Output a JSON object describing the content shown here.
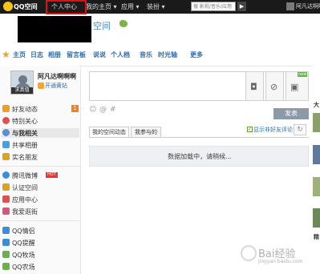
{
  "topbar": {
    "logo_text": "QQ空间",
    "nav": [
      "个人中心",
      "我的主页 ▾",
      "应用 ▾",
      "装扮 ▾"
    ],
    "search_placeholder": "搜 影视/音乐/应用",
    "search_button": "▶",
    "user_name": "阿凡达啊啊"
  },
  "header": {
    "space_text": "空间"
  },
  "mainnav": {
    "items": [
      "主页",
      "日志",
      "相册",
      "留言板",
      "说说",
      "个人档",
      "音乐",
      "时光轴",
      "更多"
    ]
  },
  "profile": {
    "name": "阿凡达啊啊啊",
    "avatar_label": "求真值",
    "vip_text": "开通黄钻"
  },
  "sidebar": {
    "group1": [
      {
        "label": "好友动态",
        "badge": "1",
        "color": "#f0a020"
      },
      {
        "label": "特别关心",
        "color": "#e05050"
      },
      {
        "label": "与我相关",
        "color": "#5a8fd0"
      },
      {
        "label": "共享相册",
        "color": "#4aa0d8"
      },
      {
        "label": "实名朋友",
        "color": "#e0a020"
      }
    ],
    "group2": [
      {
        "label": "腾讯微博",
        "hot": "HOT",
        "color": "#3b8ed8"
      },
      {
        "label": "认证空间",
        "color": "#e0a020"
      },
      {
        "label": "应用中心",
        "color": "#e05050"
      },
      {
        "label": "我爱逛街",
        "color": "#e05080"
      }
    ],
    "group3": [
      {
        "label": "QQ情侣",
        "color": "#3b8ed8"
      },
      {
        "label": "QQ提醒",
        "color": "#3b8ed8"
      },
      {
        "label": "QQ牧场",
        "color": "#6ab04c"
      },
      {
        "label": "QQ农场",
        "color": "#6ab04c"
      }
    ]
  },
  "composer": {
    "new_flag": "new",
    "post_button": "发表"
  },
  "feed": {
    "tabs": [
      "我的空间动态",
      "我参与的"
    ],
    "show_non_friend_label": "显示非好友评论",
    "loading_text": "数据加载中，请稍候..."
  },
  "right": {
    "label1": "大",
    "label2": "精"
  },
  "watermark": {
    "text": "Bai经验",
    "sub": "jingyan.baidu.com"
  }
}
